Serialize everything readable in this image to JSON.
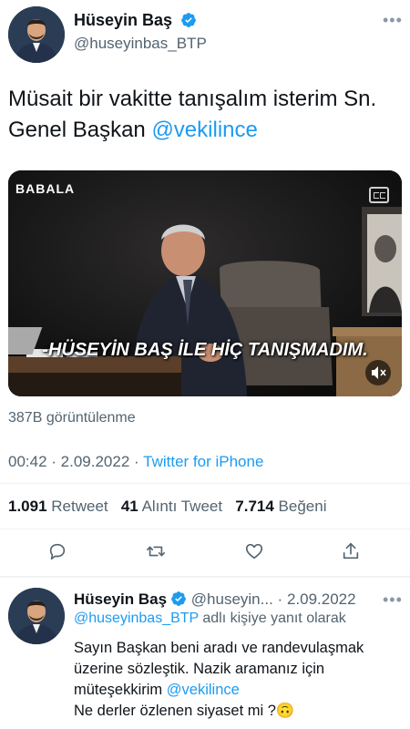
{
  "tweet": {
    "author_name": "Hüseyin Baş",
    "author_handle": "@huseyinbas_BTP",
    "text_line1": "Müsait bir vakitte tanışalım isterim Sn.",
    "text_line2_prefix": "Genel Başkan ",
    "text_mention": "@vekilince",
    "video": {
      "logo_text": "BABALA",
      "subtitle": "-HÜSEYİN BAŞ İLE HİÇ TANIŞMADIM."
    },
    "views": "387B görüntülenme",
    "time": "00:42",
    "date": "2.09.2022",
    "source": "Twitter for iPhone",
    "retweet_count": "1.091",
    "retweet_label": "Retweet",
    "quote_count": "41",
    "quote_label": "Alıntı Tweet",
    "like_count": "7.714",
    "like_label": "Beğeni"
  },
  "reply": {
    "author_name": "Hüseyin Baş",
    "author_handle": "@huseyin...",
    "date": "2.09.2022",
    "replying_to_handle": "@huseyinbas_BTP",
    "replying_to_suffix": " adlı kişiye yanıt olarak",
    "line1": "Sayın Başkan beni aradı ve randevulaşmak",
    "line2": "üzerine sözleştik. Nazik aramanız için",
    "line3_prefix": "müteşekkirim ",
    "line3_mention": "@vekilince",
    "line4": "Ne derler özlenen siyaset mi ?🙃"
  },
  "colors": {
    "accent": "#1d9bf0",
    "secondary_text": "#536471"
  },
  "icons": {
    "verified": "verified-badge-icon",
    "more": "more-dots-icon",
    "reply": "reply-icon",
    "retweet": "retweet-icon",
    "like": "like-icon",
    "share": "share-icon",
    "captions": "captions-icon",
    "mute": "mute-icon"
  }
}
